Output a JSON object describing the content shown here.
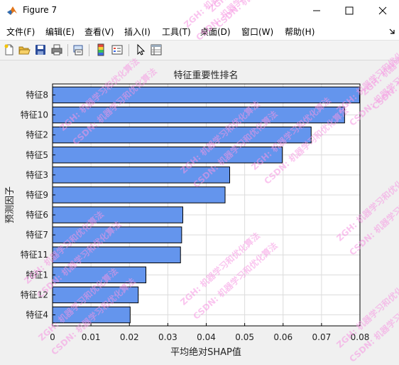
{
  "window": {
    "title": "Figure 7"
  },
  "menu": {
    "items": [
      "文件(F)",
      "编辑(E)",
      "查看(V)",
      "插入(I)",
      "工具(T)",
      "桌面(D)",
      "窗口(W)",
      "帮助(H)"
    ]
  },
  "toolbar": {
    "icons": [
      "new-figure-icon",
      "open-file-icon",
      "save-icon",
      "print-icon",
      "link-plot-icon",
      "insert-colorbar-icon",
      "insert-legend-icon",
      "pointer-icon",
      "property-inspector-icon"
    ]
  },
  "watermark": {
    "lines": [
      "ZGH: 机器学习和优化算法",
      "CSDN: 机器学习和优化算法"
    ]
  },
  "chart_data": {
    "type": "bar",
    "orientation": "horizontal",
    "title": "特征重要性排名",
    "xlabel": "平均绝对SHAP值",
    "ylabel": "预测因子",
    "categories": [
      "特征8",
      "特征10",
      "特征2",
      "特征5",
      "特征3",
      "特征9",
      "特征6",
      "特征7",
      "特征11",
      "特征1",
      "特征12",
      "特征4"
    ],
    "values": [
      0.0799,
      0.076,
      0.0673,
      0.0598,
      0.0461,
      0.0449,
      0.0339,
      0.0336,
      0.0333,
      0.0243,
      0.0223,
      0.0202
    ],
    "xlim": [
      0,
      0.08
    ],
    "xticks": [
      "0",
      "0.01",
      "0.02",
      "0.03",
      "0.04",
      "0.05",
      "0.06",
      "0.07",
      "0.08"
    ],
    "grid": true,
    "bar_color": "#6495ed",
    "edge_color": "#000000"
  }
}
